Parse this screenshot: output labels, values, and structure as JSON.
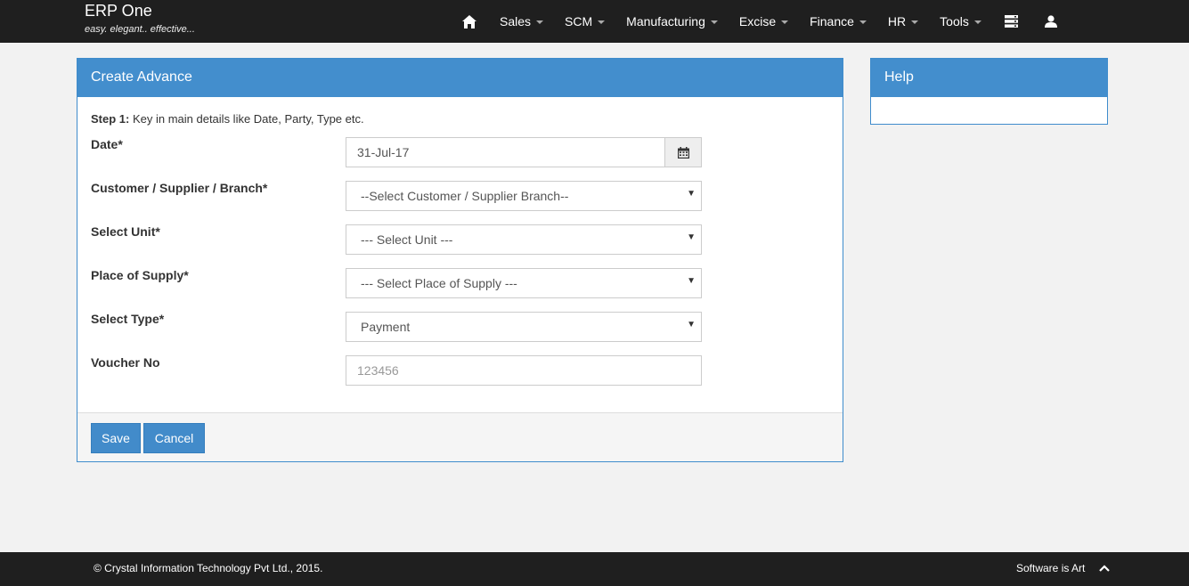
{
  "app": {
    "name": "ERP One",
    "tagline": "easy. elegant.. effective..."
  },
  "nav": {
    "items": [
      {
        "label": "Sales"
      },
      {
        "label": "SCM"
      },
      {
        "label": "Manufacturing"
      },
      {
        "label": "Excise"
      },
      {
        "label": "Finance"
      },
      {
        "label": "HR"
      },
      {
        "label": "Tools"
      }
    ]
  },
  "panel": {
    "title": "Create Advance",
    "step_label": "Step 1:",
    "step_text": " Key in main details like Date, Party, Type etc."
  },
  "form": {
    "date": {
      "label": "Date*",
      "value": "31-Jul-17"
    },
    "customer": {
      "label": "Customer / Supplier / Branch*",
      "value": "--Select Customer / Supplier Branch--"
    },
    "unit": {
      "label": "Select Unit*",
      "value": "--- Select Unit ---"
    },
    "place": {
      "label": "Place of Supply*",
      "value": "--- Select Place of Supply ---"
    },
    "type": {
      "label": "Select Type*",
      "value": "Payment"
    },
    "voucher": {
      "label": "Voucher No",
      "placeholder": "123456"
    }
  },
  "buttons": {
    "save": "Save",
    "cancel": "Cancel"
  },
  "help": {
    "title": "Help"
  },
  "footer": {
    "copyright": "© Crystal Information Technology Pvt Ltd., 2015.",
    "motto": "Software is Art"
  },
  "colors": {
    "accent": "#438ecd",
    "navbar": "#1f1f1f"
  }
}
